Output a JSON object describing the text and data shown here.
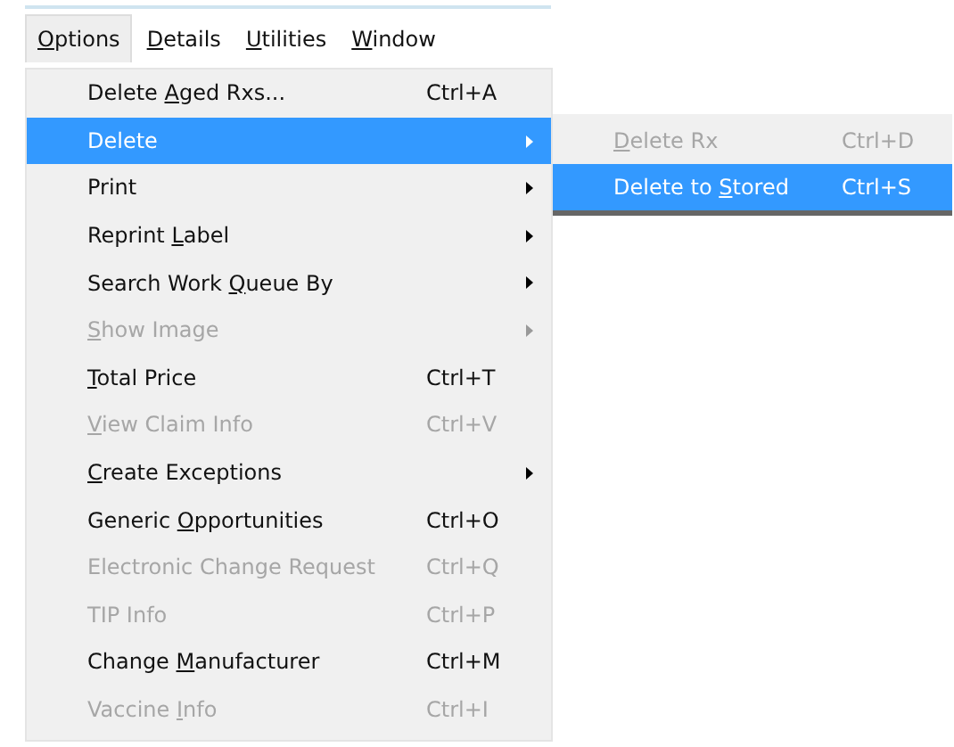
{
  "menubar": [
    {
      "mnemonic": "O",
      "label_after": "ptions",
      "selected": true
    },
    {
      "mnemonic": "D",
      "label_after": "etails",
      "selected": false
    },
    {
      "mnemonic": "U",
      "label_after": "tilities",
      "selected": false
    },
    {
      "mnemonic": "W",
      "label_after": "indow",
      "selected": false
    }
  ],
  "menu": [
    {
      "label_before": "Delete ",
      "mnemonic": "A",
      "label_after": "ged Rxs...",
      "shortcut": "Ctrl+A",
      "submenu": false,
      "disabled": false,
      "selected": false
    },
    {
      "label_before": "Delete",
      "submenu": true,
      "disabled": false,
      "selected": true
    },
    {
      "label_before": "Print",
      "submenu": true,
      "disabled": false,
      "selected": false
    },
    {
      "label_before": "Reprint ",
      "mnemonic": "L",
      "label_after": "abel",
      "submenu": true,
      "disabled": false,
      "selected": false
    },
    {
      "label_before": "Search Work ",
      "mnemonic": "Q",
      "label_after": "ueue By",
      "submenu": true,
      "disabled": false,
      "selected": false
    },
    {
      "mnemonic": "S",
      "label_after": "how Image",
      "submenu": true,
      "disabled": true,
      "selected": false
    },
    {
      "mnemonic": "T",
      "label_after": "otal Price",
      "shortcut": "Ctrl+T",
      "submenu": false,
      "disabled": false,
      "selected": false
    },
    {
      "mnemonic": "V",
      "label_after": "iew Claim Info",
      "shortcut": "Ctrl+V",
      "submenu": false,
      "disabled": true,
      "selected": false
    },
    {
      "mnemonic": "C",
      "label_after": "reate Exceptions",
      "submenu": true,
      "disabled": false,
      "selected": false
    },
    {
      "label_before": "Generic ",
      "mnemonic": "O",
      "label_after": "pportunities",
      "shortcut": "Ctrl+O",
      "submenu": false,
      "disabled": false,
      "selected": false
    },
    {
      "label_before": "Electronic Change Request",
      "shortcut": "Ctrl+Q",
      "submenu": false,
      "disabled": true,
      "selected": false
    },
    {
      "label_before": "TIP Info",
      "shortcut": "Ctrl+P",
      "submenu": false,
      "disabled": true,
      "selected": false
    },
    {
      "label_before": "Change ",
      "mnemonic": "M",
      "label_after": "anufacturer",
      "shortcut": "Ctrl+M",
      "submenu": false,
      "disabled": false,
      "selected": false
    },
    {
      "label_before": "Vaccine ",
      "mnemonic": "I",
      "label_after": "nfo",
      "shortcut": "Ctrl+I",
      "submenu": false,
      "disabled": true,
      "selected": false
    }
  ],
  "submenu": [
    {
      "mnemonic": "D",
      "label_after": "elete Rx",
      "shortcut": "Ctrl+D",
      "disabled": true,
      "selected": false
    },
    {
      "label_before": "Delete to ",
      "mnemonic": "S",
      "label_after": "tored",
      "shortcut": "Ctrl+S",
      "disabled": false,
      "selected": true
    }
  ]
}
